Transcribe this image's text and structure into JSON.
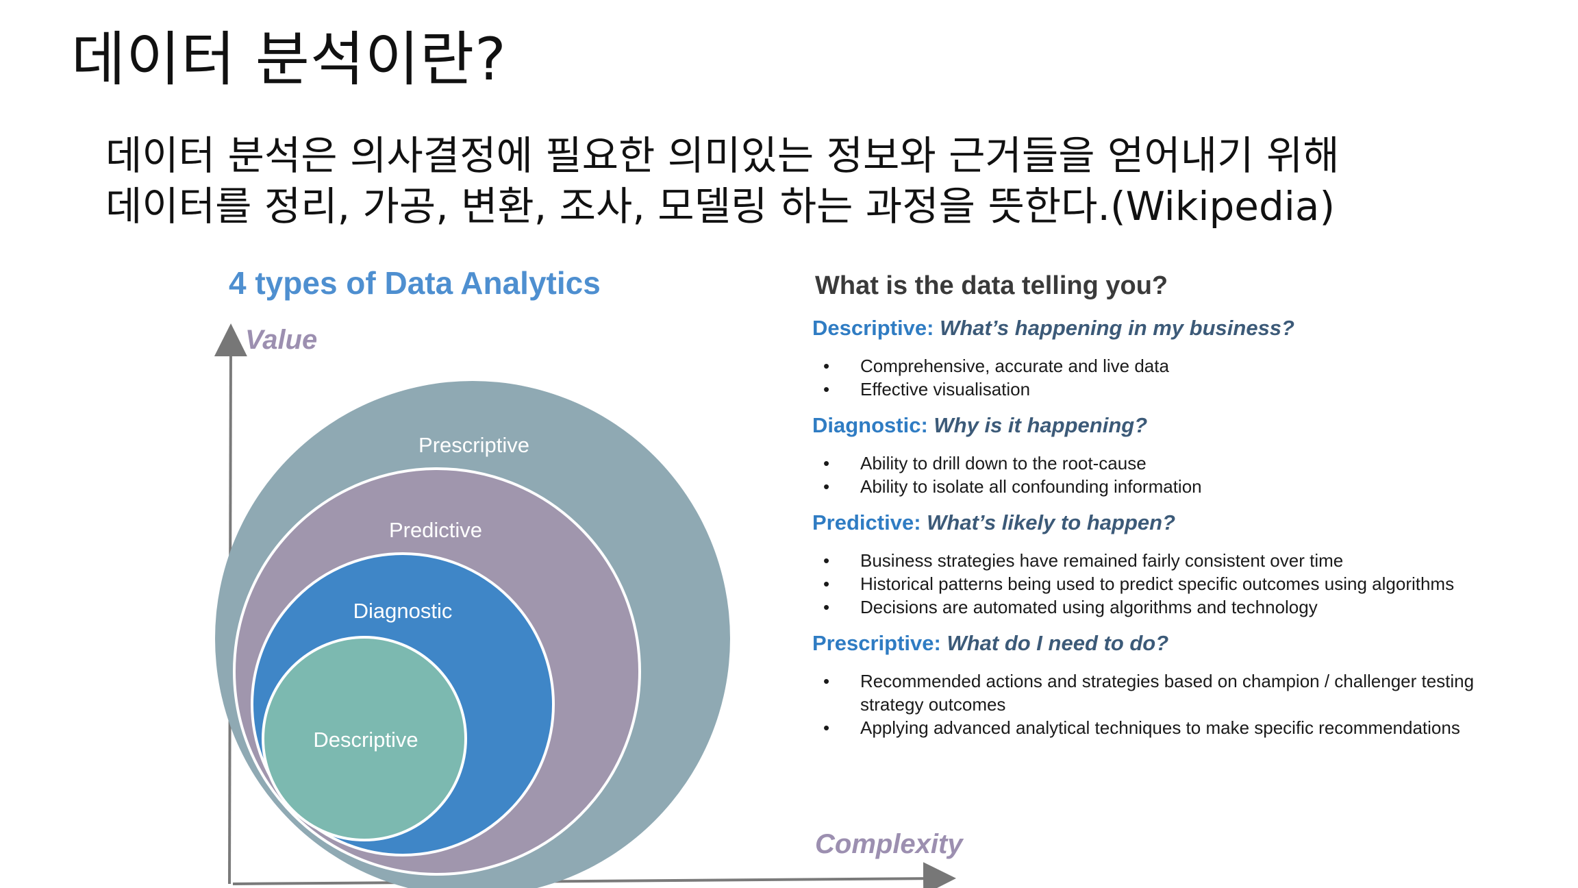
{
  "slide": {
    "title": "데이터 분석이란?",
    "intro_line1": "데이터 분석은 의사결정에 필요한 의미있는 정보와 근거들을 얻어내기 위해",
    "intro_line2": "데이터를 정리, 가공, 변환, 조사, 모델링 하는 과정을 뜻한다.(Wikipedia)"
  },
  "figure": {
    "title": "4 types of Data Analytics",
    "y_axis_label": "Value",
    "x_axis_label": "Complexity",
    "rings": [
      {
        "label": "Prescriptive",
        "color": "#8fa9b3"
      },
      {
        "label": "Predictive",
        "color": "#a096ad"
      },
      {
        "label": "Diagnostic",
        "color": "#3f86c7"
      },
      {
        "label": "Descriptive",
        "color": "#7cb9b0"
      }
    ]
  },
  "panel": {
    "question": "What is the data telling you?",
    "sections": [
      {
        "name": "Descriptive:",
        "question": "What’s happening in my business?",
        "bullets": [
          "Comprehensive, accurate and live data",
          "Effective visualisation"
        ]
      },
      {
        "name": "Diagnostic:",
        "question": "Why is it happening?",
        "bullets": [
          "Ability to drill down to the root-cause",
          "Ability to isolate all confounding information"
        ]
      },
      {
        "name": "Predictive:",
        "question": "What’s likely to happen?",
        "bullets": [
          "Business strategies have remained fairly consistent over time",
          "Historical patterns being used to predict specific outcomes using algorithms",
          "Decisions are automated using algorithms and technology"
        ]
      },
      {
        "name": "Prescriptive:",
        "question": "What do I need to do?",
        "bullets": [
          "Recommended actions and strategies based on champion / challenger testing strategy outcomes",
          "Applying advanced analytical techniques to make specific recommendations"
        ]
      }
    ]
  }
}
